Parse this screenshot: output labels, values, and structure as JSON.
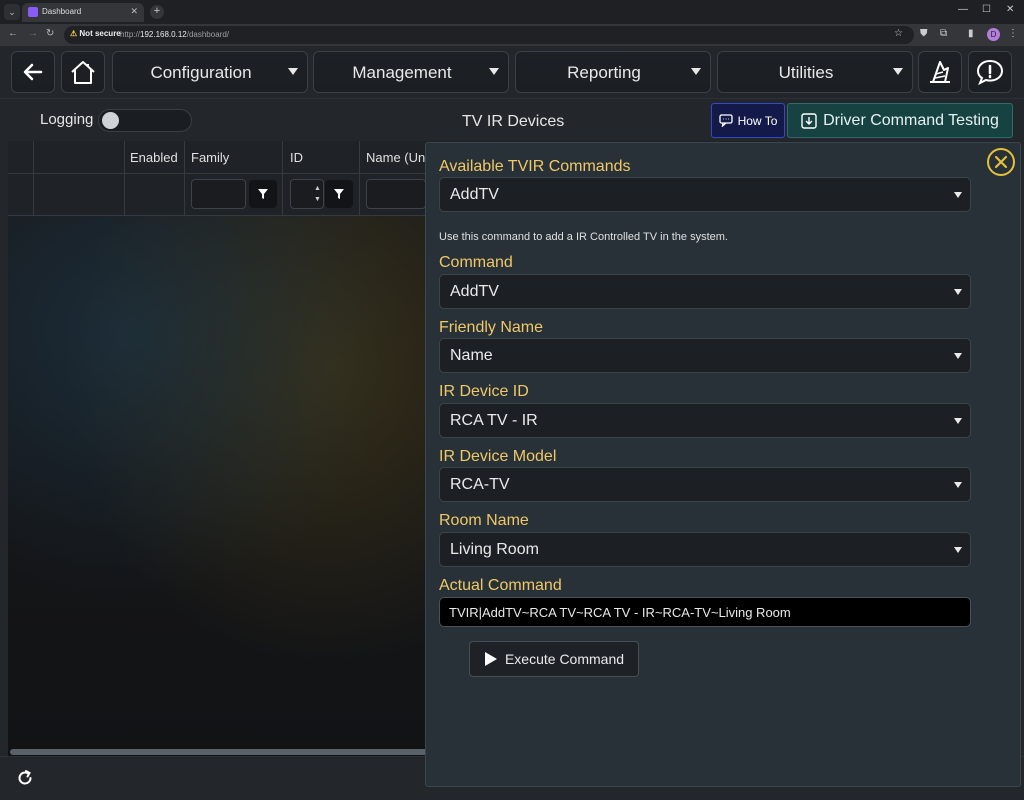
{
  "browser": {
    "tab_title": "Dashboard",
    "not_secure": "Not secure",
    "url_prefix": "http://",
    "url_host": "192.168.0.12",
    "url_path": "/dashboard/",
    "profile_initial": "D"
  },
  "nav": {
    "menus": [
      "Configuration",
      "Management",
      "Reporting",
      "Utilities"
    ]
  },
  "subbar": {
    "logging_label": "Logging",
    "logging_on": false,
    "page_title": "TV IR Devices",
    "howto_label": "How To",
    "driver_testing_label": "Driver Command Testing"
  },
  "table": {
    "columns": [
      "Enabled",
      "Family",
      "ID",
      "Name (Uni"
    ]
  },
  "panel": {
    "available_label": "Available TVIR Commands",
    "available_value": "AddTV",
    "description": "Use this command to add a IR Controlled TV in the system.",
    "fields": [
      {
        "label": "Command",
        "value": "AddTV"
      },
      {
        "label": "Friendly Name",
        "value": "Name"
      },
      {
        "label": "IR Device ID",
        "value": "RCA TV - IR"
      },
      {
        "label": "IR Device Model",
        "value": "RCA-TV"
      },
      {
        "label": "Room Name",
        "value": "Living Room"
      }
    ],
    "actual_label": "Actual Command",
    "actual_value": "TVIR|AddTV~RCA TV~RCA TV - IR~RCA-TV~Living Room",
    "execute_label": "Execute Command"
  },
  "colors": {
    "accent_label": "#f0c866",
    "howto_bg": "#131a4a",
    "driver_bg": "#174242",
    "close_ring": "#e3c13b"
  }
}
